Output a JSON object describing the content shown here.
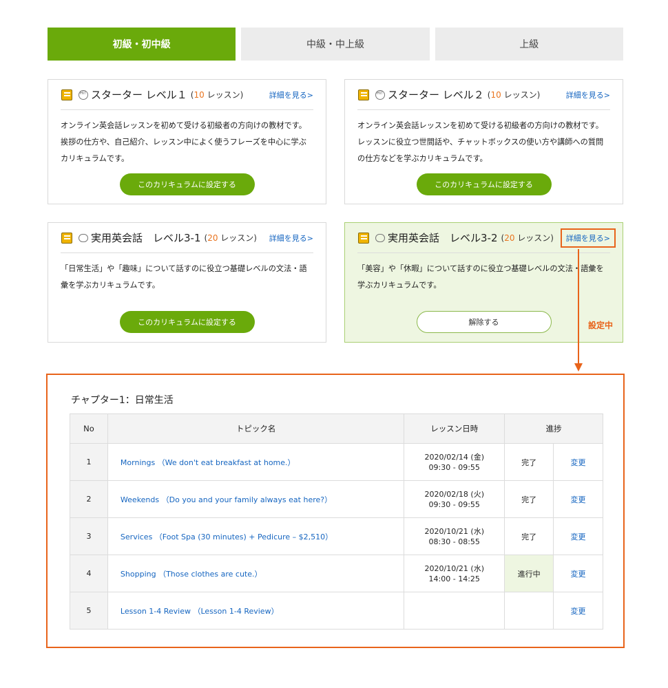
{
  "tabs": [
    {
      "label": "初級・初中級",
      "active": true
    },
    {
      "label": "中級・中上級",
      "active": false
    },
    {
      "label": "上級",
      "active": false
    }
  ],
  "cards": [
    {
      "icon": "speech-bubble-hi-icon",
      "title": "スターター レベル１",
      "count_prefix": "(",
      "count": "10",
      "count_suffix": " レッスン)",
      "detail": "詳細を見る>",
      "desc": "オンライン英会話レッスンを初めて受ける初級者の方向けの教材です。挨拶の仕方や、自己紹介、レッスン中によく使うフレーズを中心に学ぶカリキュラムです。",
      "button": "このカリキュラムに設定する"
    },
    {
      "icon": "speech-bubble-hi-icon",
      "title": "スターター レベル２",
      "count_prefix": "(",
      "count": "10",
      "count_suffix": " レッスン)",
      "detail": "詳細を見る>",
      "desc": "オンライン英会話レッスンを初めて受ける初級者の方向けの教材です。レッスンに役立つ世間話や、チャットボックスの使い方や講師への質問の仕方などを学ぶカリキュラムです。",
      "button": "このカリキュラムに設定する"
    },
    {
      "icon": "speech-bubble-icon",
      "title": "実用英会話　レベル3-1",
      "count_prefix": "(",
      "count": "20",
      "count_suffix": " レッスン)",
      "detail": "詳細を見る>",
      "desc": "「日常生活」や「趣味」について話すのに役立つ基礎レベルの文法・語彙を学ぶカリキュラムです。",
      "button": "このカリキュラムに設定する"
    },
    {
      "icon": "speech-bubble-icon",
      "title": "実用英会話　レベル3-2",
      "count_prefix": "(",
      "count": "20",
      "count_suffix": " レッスン)",
      "detail": "詳細を見る>",
      "desc": "「美容」や「休暇」について話すのに役立つ基礎レベルの文法・語彙を学ぶカリキュラムです。",
      "button": "解除する",
      "status": "設定中"
    }
  ],
  "chapter": {
    "title": "チャプター1：日常生活",
    "headers": {
      "no": "No",
      "topic": "トピック名",
      "date": "レッスン日時",
      "progress": "進捗"
    },
    "rows": [
      {
        "no": "1",
        "topic": "Mornings （We don't eat breakfast at home.）",
        "date": "2020/02/14 (金)",
        "time": "09:30 - 09:55",
        "progress": "完了",
        "change": "変更"
      },
      {
        "no": "2",
        "topic": "Weekends （Do you and your family always eat here?）",
        "date": "2020/02/18 (火)",
        "time": "09:30 - 09:55",
        "progress": "完了",
        "change": "変更"
      },
      {
        "no": "3",
        "topic": "Services （Foot Spa (30 minutes) + Pedicure – $2,510）",
        "date": "2020/10/21 (水)",
        "time": "08:30 - 08:55",
        "progress": "完了",
        "change": "変更"
      },
      {
        "no": "4",
        "topic": "Shopping （Those clothes are cute.）",
        "date": "2020/10/21 (水)",
        "time": "14:00 - 14:25",
        "progress": "進行中",
        "change": "変更"
      },
      {
        "no": "5",
        "topic": "Lesson 1-4 Review （Lesson 1-4 Review）",
        "date": "",
        "time": "",
        "progress": "",
        "change": "変更"
      }
    ]
  },
  "colors": {
    "accent": "#6aaa0b",
    "highlight": "#e8631a",
    "link": "#1565c0",
    "selected_bg": "#eef6e1"
  }
}
